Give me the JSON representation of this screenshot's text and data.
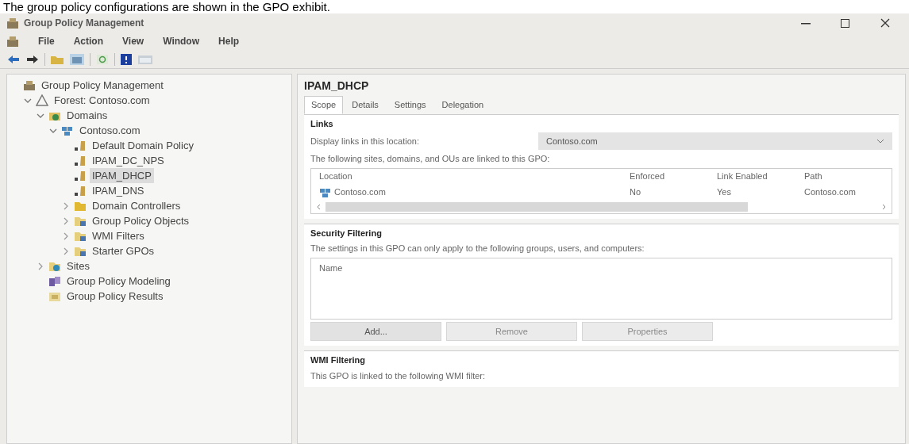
{
  "caption": "The group policy configurations are shown in the GPO exhibit.",
  "window": {
    "title": "Group Policy Management"
  },
  "menu": [
    "File",
    "Action",
    "View",
    "Window",
    "Help"
  ],
  "tree": [
    {
      "label": "Group Policy Management",
      "kind": "root",
      "selected": false,
      "children": [
        {
          "label": "Forest: Contoso.com",
          "kind": "forest",
          "expanded": true,
          "selected": false,
          "children": [
            {
              "label": "Domains",
              "kind": "domains",
              "expanded": true,
              "selected": false,
              "children": [
                {
                  "label": "Contoso.com",
                  "kind": "domain",
                  "expanded": true,
                  "selected": false,
                  "children": [
                    {
                      "label": "Default Domain Policy",
                      "kind": "gpo",
                      "selected": false
                    },
                    {
                      "label": "IPAM_DC_NPS",
                      "kind": "gpo",
                      "selected": false
                    },
                    {
                      "label": "IPAM_DHCP",
                      "kind": "gpo",
                      "selected": true
                    },
                    {
                      "label": "IPAM_DNS",
                      "kind": "gpo",
                      "selected": false
                    },
                    {
                      "label": "Domain Controllers",
                      "kind": "ou",
                      "expanded": false,
                      "selected": false
                    },
                    {
                      "label": "Group Policy Objects",
                      "kind": "folder",
                      "expanded": false,
                      "selected": false
                    },
                    {
                      "label": "WMI Filters",
                      "kind": "folder",
                      "expanded": false,
                      "selected": false
                    },
                    {
                      "label": "Starter GPOs",
                      "kind": "folder",
                      "expanded": false,
                      "selected": false
                    }
                  ]
                }
              ]
            },
            {
              "label": "Sites",
              "kind": "sites",
              "expanded": false,
              "selected": false
            },
            {
              "label": "Group Policy Modeling",
              "kind": "modeling",
              "selected": false
            },
            {
              "label": "Group Policy Results",
              "kind": "results",
              "selected": false
            }
          ]
        }
      ]
    }
  ],
  "detail": {
    "title": "IPAM_DHCP",
    "tabs": [
      {
        "label": "Scope",
        "selected": true
      },
      {
        "label": "Details",
        "selected": false
      },
      {
        "label": "Settings",
        "selected": false
      },
      {
        "label": "Delegation",
        "selected": false
      }
    ],
    "links": {
      "heading": "Links",
      "location_label": "Display links in this location:",
      "location_value": "Contoso.com",
      "note": "The following sites, domains, and OUs are linked to this GPO:",
      "columns": [
        "Location",
        "Enforced",
        "Link Enabled",
        "Path"
      ],
      "rows": [
        [
          "Contoso.com",
          "No",
          "Yes",
          "Contoso.com"
        ]
      ]
    },
    "security": {
      "heading": "Security Filtering",
      "note": "The settings in this GPO can only apply to the following groups, users, and computers:",
      "columns": [
        "Name"
      ],
      "buttons": [
        {
          "label": "Add...",
          "disabled": false
        },
        {
          "label": "Remove",
          "disabled": true
        },
        {
          "label": "Properties",
          "disabled": true
        }
      ]
    },
    "wmi": {
      "heading": "WMI Filtering",
      "note": "This GPO is linked to the following WMI filter:"
    }
  }
}
